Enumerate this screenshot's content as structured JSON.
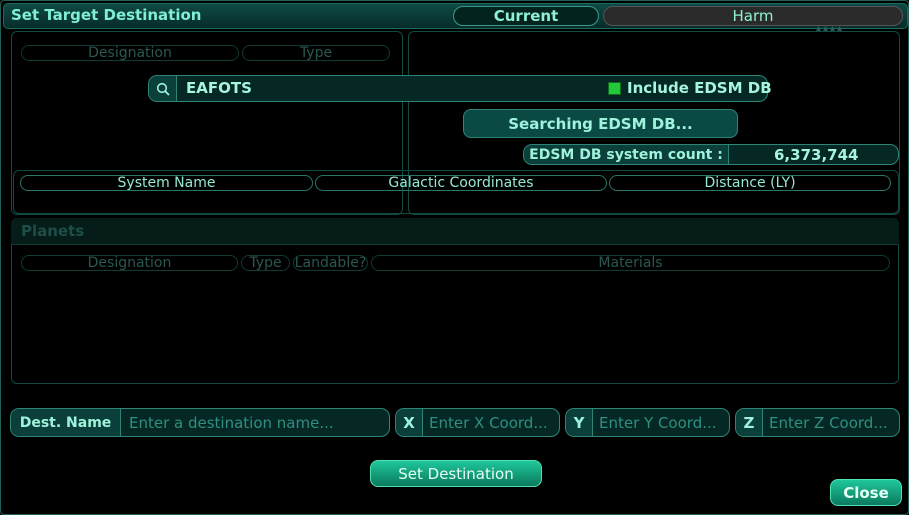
{
  "window": {
    "title": "Set Target Destination"
  },
  "tabs": {
    "current": "Current",
    "harm": "Harm"
  },
  "left_panel": {
    "col_designation": "Designation",
    "col_type": "Type"
  },
  "search": {
    "value": "EAFOTS",
    "include_edsm_label": "Include EDSM DB"
  },
  "status": {
    "searching": "Searching EDSM DB...",
    "count_label": "EDSM DB system count :",
    "count_value": "6,373,744"
  },
  "systems_table": {
    "col_name": "System Name",
    "col_coords": "Galactic Coordinates",
    "col_distance": "Distance (LY)"
  },
  "planets": {
    "title": "Planets",
    "col_designation": "Designation",
    "col_type": "Type",
    "col_landable": "Landable?",
    "col_materials": "Materials"
  },
  "destination": {
    "name_label": "Dest. Name",
    "name_placeholder": "Enter a destination name...",
    "x_label": "X",
    "x_placeholder": "Enter X Coord...",
    "y_label": "Y",
    "y_placeholder": "Enter Y Coord...",
    "z_label": "Z",
    "z_placeholder": "Enter Z Coord..."
  },
  "buttons": {
    "set_destination": "Set Destination",
    "close": "Close"
  },
  "colors": {
    "accent": "#7ff0d4",
    "background": "#000000",
    "panel_border": "#1b6a60",
    "button_green": "#12a680",
    "checkbox": "#22c93a"
  },
  "icons": {
    "search": "search-icon",
    "checkbox": "checkbox-icon"
  }
}
